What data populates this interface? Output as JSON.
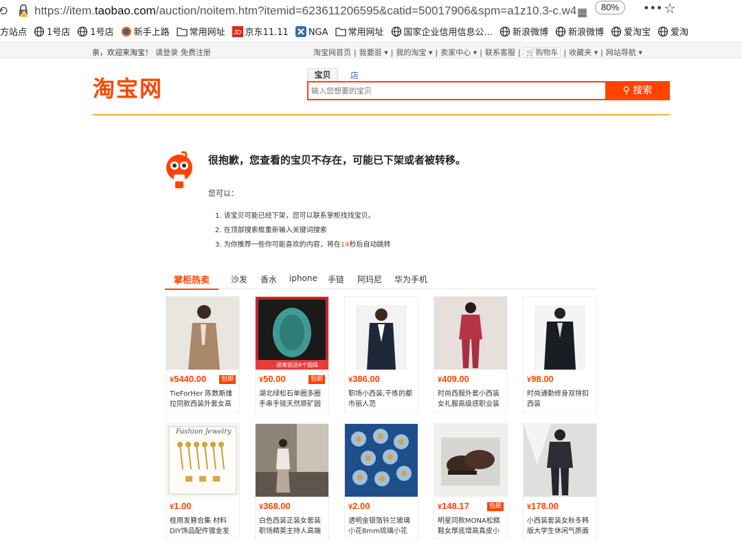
{
  "browser": {
    "url_prefix": "https://item.",
    "url_domain": "taobao.com",
    "url_rest": "/auction/noitem.htm?itemid=623611206595&catid=50017906&spm=a1z10.3-c.w4",
    "zoom": "80%",
    "more": "•••",
    "star": "☆"
  },
  "bookmarks": [
    {
      "label": "方站点",
      "icon": "none"
    },
    {
      "label": "1号店",
      "icon": "globe-icon"
    },
    {
      "label": "1号店",
      "icon": "globe-icon"
    },
    {
      "label": "新手上路",
      "icon": "firefox-icon"
    },
    {
      "label": "常用网址",
      "icon": "folder-icon"
    },
    {
      "label": "京东11.11",
      "icon": "jd-icon"
    },
    {
      "label": "NGA",
      "icon": "nga-icon"
    },
    {
      "label": "常用网址",
      "icon": "folder-icon"
    },
    {
      "label": "国家企业信用信息公...",
      "icon": "globe-icon"
    },
    {
      "label": "新浪微博",
      "icon": "globe-icon"
    },
    {
      "label": "新浪微博",
      "icon": "globe-icon"
    },
    {
      "label": "爱淘宝",
      "icon": "globe-icon"
    },
    {
      "label": "爱淘",
      "icon": "globe-icon"
    }
  ],
  "sitenav": {
    "welcome": "亲，欢迎来淘宝！",
    "login": "请登录",
    "register": "免费注册",
    "links": [
      "淘宝网首页",
      "我要逛 ▾",
      "我的淘宝 ▾",
      "卖家中心 ▾",
      "联系客服",
      "购物车",
      "收藏夹 ▾",
      "网站导航 ▾"
    ]
  },
  "header": {
    "logo": "淘宝网",
    "tab_item": "宝贝",
    "tab_shop": "店铺",
    "search_placeholder": "输入您想要的宝贝",
    "search_button": "搜索"
  },
  "error": {
    "title": "很抱歉，您查看的宝贝不存在，可能已下架或者被转移。",
    "you_can": "您可以：",
    "tip1": "1. 该宝贝可能已经下架，您可以联系掌柜找找宝贝。",
    "tip2": "2. 在顶部搜索框重新输入关键词搜索",
    "tip3_before": "3. 为你推荐一些你可能喜欢的内容，将在",
    "tip3_seconds": "14",
    "tip3_after": "秒后自动跳转"
  },
  "rec_tabs": [
    "掌柜热卖",
    "沙发",
    "香水",
    "iphone",
    "手链",
    "阿玛尼",
    "华为手机"
  ],
  "products": [
    {
      "price": "5440.00",
      "tag": "包邮",
      "title": "TieForHer 陈数斯维拉同款西装外套女高",
      "img": "suit-beige"
    },
    {
      "price": "50.00",
      "tag": "包邮",
      "title": "湖北绿松石单圈多圈手串手链天然原矿圆",
      "img": "turquoise",
      "banner": "进来就送6个圆珠"
    },
    {
      "price": "386.00",
      "tag": "",
      "title": "职场小西装,干练的都市丽人范",
      "img": "blazer-navy"
    },
    {
      "price": "409.00",
      "tag": "",
      "title": "时尚西服外套小西装女礼服高级感职业装",
      "img": "suit-red"
    },
    {
      "price": "98.00",
      "tag": "",
      "title": "时尚通勤修身双排扣西装",
      "img": "blazer-black"
    },
    {
      "price": "1.00",
      "tag": "",
      "title": "桂用发簪合集 材料DIY饰品配件镀金发",
      "img": "hairpins",
      "overlay": "Fashion Jewelry"
    },
    {
      "price": "368.00",
      "tag": "",
      "title": "白色西装正装女套装职场精英主持人高端",
      "img": "room"
    },
    {
      "price": "2.00",
      "tag": "",
      "title": "透明金银箔铃兰玻璃小花8mm琉璃小花",
      "img": "glass-flowers"
    },
    {
      "price": "148.17",
      "tag": "包邮",
      "title": "明星同款MONA松糕鞋女厚底增高真皮小",
      "img": "shoes"
    },
    {
      "price": "178.00",
      "tag": "",
      "title": "小西装套装女秋冬韩版大学生休闲气质面",
      "img": "suit-dark"
    }
  ],
  "colors": {
    "brand": "#ff4400",
    "divider": "#f9b032"
  }
}
